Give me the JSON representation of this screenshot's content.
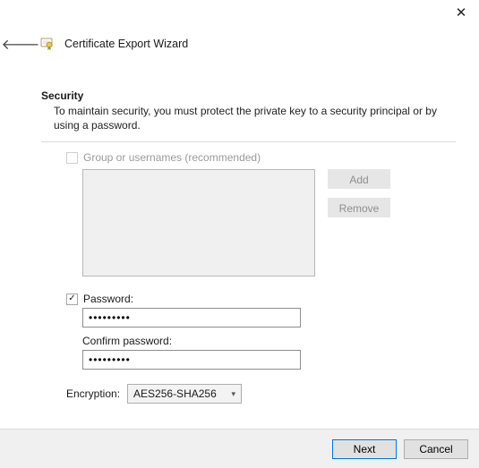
{
  "window": {
    "title": "Certificate Export Wizard"
  },
  "section": {
    "title": "Security",
    "description": "To maintain security, you must protect the private key to a security principal or by using a password."
  },
  "groups": {
    "checkbox_label": "Group or usernames (recommended)",
    "add_button": "Add",
    "remove_button": "Remove"
  },
  "password": {
    "checkbox_label": "Password:",
    "value": "•••••••••",
    "confirm_label": "Confirm password:",
    "confirm_value": "•••••••••"
  },
  "encryption": {
    "label": "Encryption:",
    "selected": "AES256-SHA256"
  },
  "buttons": {
    "next": "Next",
    "cancel": "Cancel"
  }
}
